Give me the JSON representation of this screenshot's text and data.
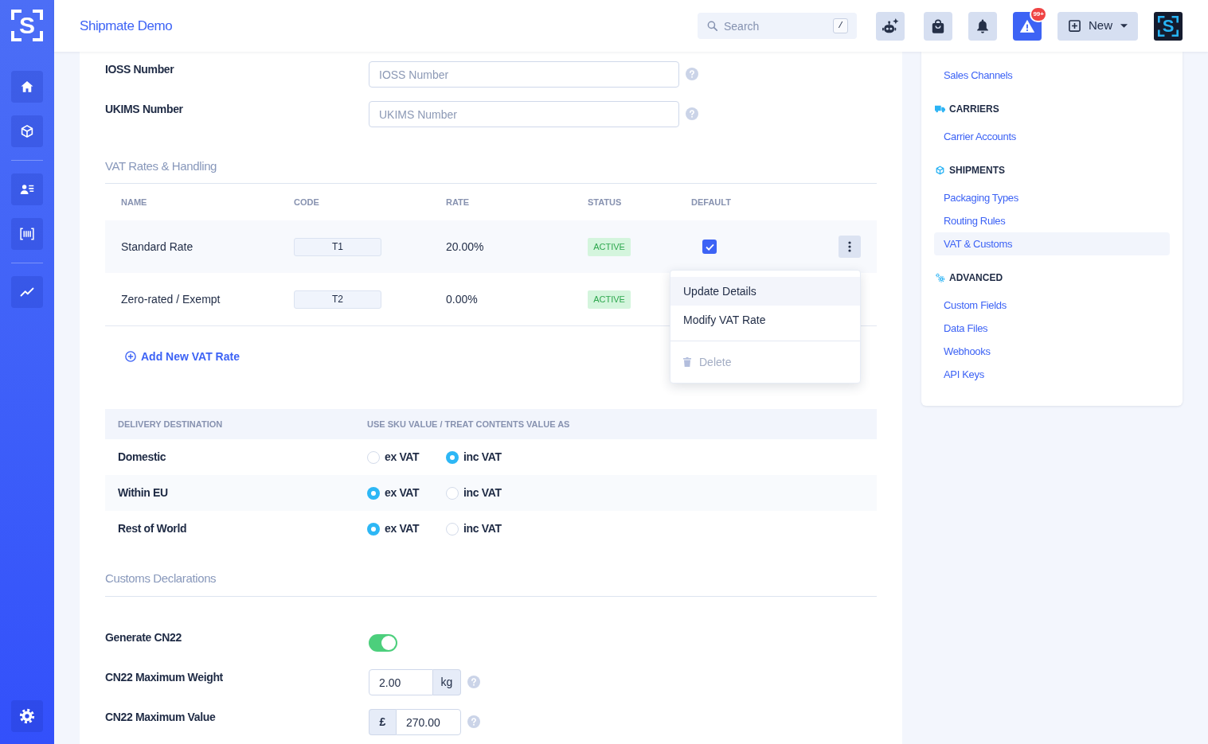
{
  "sidebar": {
    "logo": "S"
  },
  "top_bar": {
    "title": "Shipmate Demo",
    "search": {
      "placeholder": "Search",
      "shortcut": "/"
    },
    "alerts_badge": "99+",
    "new_button": "New",
    "account_logo": "S"
  },
  "tax_ids": [
    {
      "label": "IOSS Number",
      "placeholder": "IOSS Number"
    },
    {
      "label": "UKIMS Number",
      "placeholder": "UKIMS Number"
    }
  ],
  "vat_rates": {
    "title": "VAT Rates & Handling",
    "columns": [
      "NAME",
      "CODE",
      "RATE",
      "STATUS",
      "DEFAULT"
    ],
    "rows": [
      {
        "name": "Standard Rate",
        "code": "T1",
        "rate": "20.00%",
        "status": "ACTIVE",
        "default": true,
        "selected": true
      },
      {
        "name": "Zero-rated / Exempt",
        "code": "T2",
        "rate": "0.00%",
        "status": "ACTIVE",
        "selected": false
      }
    ],
    "row_menu": {
      "items": [
        {
          "kind": "action",
          "label": "Update Details",
          "selected": true,
          "disabled": false
        },
        {
          "kind": "action",
          "label": "Modify VAT Rate",
          "selected": false,
          "disabled": false
        },
        {
          "kind": "delete",
          "label": "Delete",
          "selected": false,
          "disabled": true
        }
      ]
    },
    "add_link": "Add New VAT Rate"
  },
  "delivery": {
    "columns": [
      "DELIVERY DESTINATION",
      "USE SKU VALUE / TREAT CONTENTS VALUE AS"
    ],
    "rows": [
      {
        "destination": "Domestic",
        "options": [
          {
            "label": "ex VAT",
            "selected": false
          },
          {
            "label": "inc VAT",
            "selected": true
          }
        ]
      },
      {
        "destination": "Within EU",
        "options": [
          {
            "label": "ex VAT",
            "selected": true
          },
          {
            "label": "inc VAT",
            "selected": false
          }
        ]
      },
      {
        "destination": "Rest of World",
        "options": [
          {
            "label": "ex VAT",
            "selected": true
          },
          {
            "label": "inc VAT",
            "selected": false
          }
        ]
      }
    ]
  },
  "customs": {
    "title": "Customs Declarations",
    "fields": [
      {
        "kind": "toggle",
        "label": "Generate CN22",
        "on": true
      },
      {
        "kind": "suffix_input",
        "label": "CN22 Maximum Weight",
        "value": "2.00",
        "unit": "kg"
      },
      {
        "kind": "prefix_input",
        "label": "CN22 Maximum Value",
        "value": "270.00",
        "unit": "£"
      }
    ]
  },
  "settings_nav": {
    "sections": [
      {
        "items": [
          {
            "label": "Sales Channels",
            "selected": false
          }
        ]
      },
      {
        "title": "CARRIERS",
        "items": [
          {
            "label": "Carrier Accounts",
            "selected": false
          }
        ]
      },
      {
        "title": "SHIPMENTS",
        "items": [
          {
            "label": "Packaging Types",
            "selected": false
          },
          {
            "label": "Routing Rules",
            "selected": false
          },
          {
            "label": "VAT & Customs",
            "selected": true
          }
        ]
      },
      {
        "title": "ADVANCED",
        "items": [
          {
            "label": "Custom Fields",
            "selected": false
          },
          {
            "label": "Data Files",
            "selected": false
          },
          {
            "label": "Webhooks",
            "selected": false
          },
          {
            "label": "API Keys",
            "selected": false
          }
        ]
      }
    ]
  }
}
